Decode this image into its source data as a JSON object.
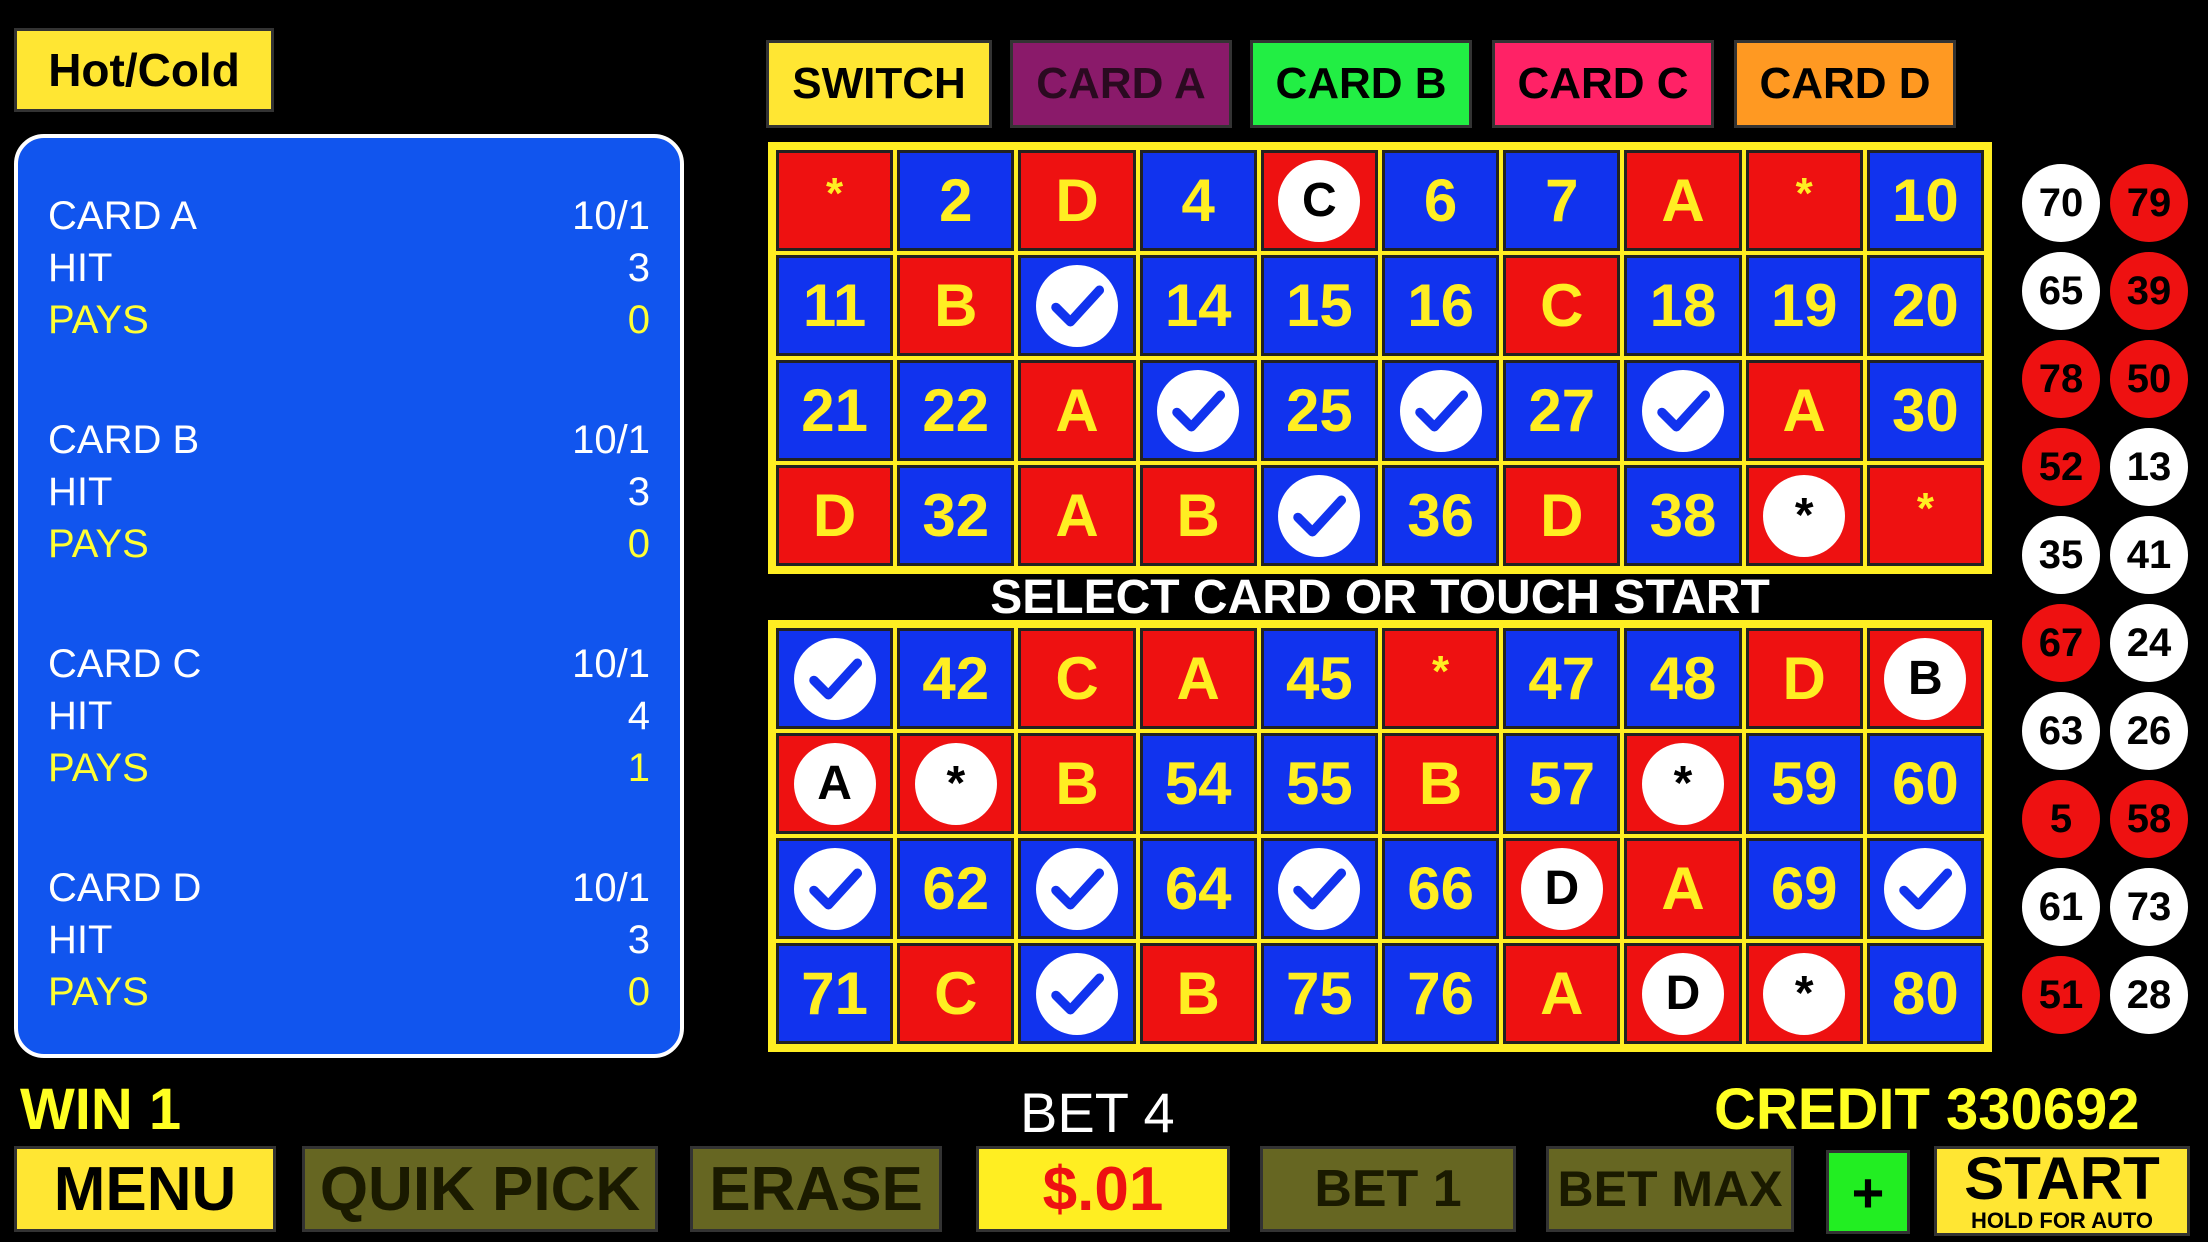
{
  "top": {
    "hot_cold": "Hot/Cold",
    "tabs": [
      {
        "label": "SWITCH"
      },
      {
        "label": "CARD A"
      },
      {
        "label": "CARD B"
      },
      {
        "label": "CARD C"
      },
      {
        "label": "CARD D"
      }
    ]
  },
  "info": {
    "cards": [
      {
        "name": "CARD A",
        "odds": "10/1",
        "hit_label": "HIT",
        "hit": "3",
        "pays_label": "PAYS",
        "pays": "0"
      },
      {
        "name": "CARD B",
        "odds": "10/1",
        "hit_label": "HIT",
        "hit": "3",
        "pays_label": "PAYS",
        "pays": "0"
      },
      {
        "name": "CARD C",
        "odds": "10/1",
        "hit_label": "HIT",
        "hit": "4",
        "pays_label": "PAYS",
        "pays": "1"
      },
      {
        "name": "CARD D",
        "odds": "10/1",
        "hit_label": "HIT",
        "hit": "3",
        "pays_label": "PAYS",
        "pays": "0"
      }
    ]
  },
  "prompt": "SELECT CARD OR TOUCH START",
  "board": {
    "top": [
      [
        "r",
        "*"
      ],
      [
        "b",
        "2"
      ],
      [
        "r",
        "D"
      ],
      [
        "b",
        "4"
      ],
      [
        "r",
        "circle:C"
      ],
      [
        "b",
        "6"
      ],
      [
        "b",
        "7"
      ],
      [
        "r",
        "A"
      ],
      [
        "r",
        "*"
      ],
      [
        "b",
        "10"
      ],
      [
        "b",
        "11"
      ],
      [
        "r",
        "B"
      ],
      [
        "b",
        "check"
      ],
      [
        "b",
        "14"
      ],
      [
        "b",
        "15"
      ],
      [
        "b",
        "16"
      ],
      [
        "r",
        "C"
      ],
      [
        "b",
        "18"
      ],
      [
        "b",
        "19"
      ],
      [
        "b",
        "20"
      ],
      [
        "b",
        "21"
      ],
      [
        "b",
        "22"
      ],
      [
        "r",
        "A"
      ],
      [
        "b",
        "check"
      ],
      [
        "b",
        "25"
      ],
      [
        "b",
        "check"
      ],
      [
        "b",
        "27"
      ],
      [
        "b",
        "check"
      ],
      [
        "r",
        "A"
      ],
      [
        "b",
        "30"
      ],
      [
        "r",
        "D"
      ],
      [
        "b",
        "32"
      ],
      [
        "r",
        "A"
      ],
      [
        "r",
        "B"
      ],
      [
        "b",
        "check"
      ],
      [
        "b",
        "36"
      ],
      [
        "r",
        "D"
      ],
      [
        "b",
        "38"
      ],
      [
        "r",
        "circle:*"
      ],
      [
        "r",
        "*"
      ]
    ],
    "bottom": [
      [
        "b",
        "check"
      ],
      [
        "b",
        "42"
      ],
      [
        "r",
        "C"
      ],
      [
        "r",
        "A"
      ],
      [
        "b",
        "45"
      ],
      [
        "r",
        "*"
      ],
      [
        "b",
        "47"
      ],
      [
        "b",
        "48"
      ],
      [
        "r",
        "D"
      ],
      [
        "r",
        "circle:B"
      ],
      [
        "r",
        "circle:A"
      ],
      [
        "r",
        "circle:*"
      ],
      [
        "r",
        "B"
      ],
      [
        "b",
        "54"
      ],
      [
        "b",
        "55"
      ],
      [
        "r",
        "B"
      ],
      [
        "b",
        "57"
      ],
      [
        "r",
        "circle:*"
      ],
      [
        "b",
        "59"
      ],
      [
        "b",
        "60"
      ],
      [
        "b",
        "check"
      ],
      [
        "b",
        "62"
      ],
      [
        "b",
        "check"
      ],
      [
        "b",
        "64"
      ],
      [
        "b",
        "check"
      ],
      [
        "b",
        "66"
      ],
      [
        "r",
        "circle:D"
      ],
      [
        "r",
        "A"
      ],
      [
        "b",
        "69"
      ],
      [
        "b",
        "check"
      ],
      [
        "b",
        "71"
      ],
      [
        "r",
        "C"
      ],
      [
        "b",
        "check"
      ],
      [
        "r",
        "B"
      ],
      [
        "b",
        "75"
      ],
      [
        "b",
        "76"
      ],
      [
        "r",
        "A"
      ],
      [
        "r",
        "circle:D"
      ],
      [
        "r",
        "circle:*"
      ],
      [
        "b",
        "80"
      ]
    ]
  },
  "balls": [
    {
      "n": "70",
      "c": "white"
    },
    {
      "n": "79",
      "c": "red"
    },
    {
      "n": "65",
      "c": "white"
    },
    {
      "n": "39",
      "c": "red"
    },
    {
      "n": "78",
      "c": "red"
    },
    {
      "n": "50",
      "c": "red"
    },
    {
      "n": "52",
      "c": "red"
    },
    {
      "n": "13",
      "c": "white"
    },
    {
      "n": "35",
      "c": "white"
    },
    {
      "n": "41",
      "c": "white"
    },
    {
      "n": "67",
      "c": "red"
    },
    {
      "n": "24",
      "c": "white"
    },
    {
      "n": "63",
      "c": "white"
    },
    {
      "n": "26",
      "c": "white"
    },
    {
      "n": "5",
      "c": "red"
    },
    {
      "n": "58",
      "c": "red"
    },
    {
      "n": "61",
      "c": "white"
    },
    {
      "n": "73",
      "c": "white"
    },
    {
      "n": "51",
      "c": "red"
    },
    {
      "n": "28",
      "c": "white"
    }
  ],
  "status": {
    "win": "WIN 1",
    "bet": "BET 4",
    "credit": "CREDIT 330692"
  },
  "buttons": {
    "menu": "MENU",
    "quik_pick": "QUIK PICK",
    "erase": "ERASE",
    "denom": "$.01",
    "bet1": "BET 1",
    "bet_max": "BET MAX",
    "plus": "+",
    "start": "START",
    "start_sub": "HOLD FOR AUTO"
  },
  "colors": {
    "board_blue": "#1133ee",
    "board_red": "#ee1111",
    "board_frame": "#ffee22",
    "panel_blue": "#1155ee"
  }
}
